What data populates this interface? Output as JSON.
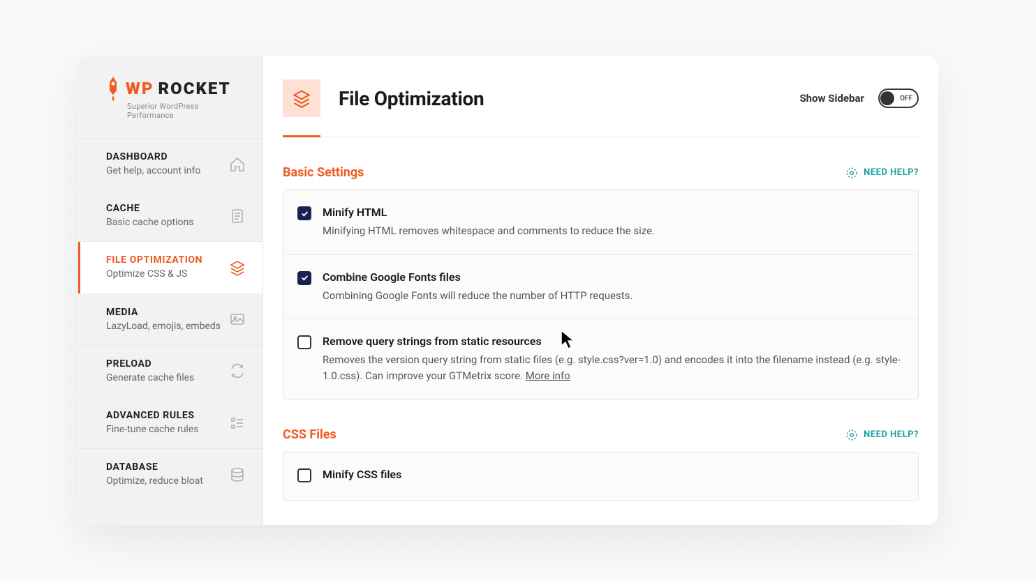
{
  "brand": {
    "wp": "WP",
    "rocket": "ROCKET",
    "tagline": "Superior WordPress Performance"
  },
  "nav": [
    {
      "title": "DASHBOARD",
      "sub": "Get help, account info"
    },
    {
      "title": "CACHE",
      "sub": "Basic cache options"
    },
    {
      "title": "FILE OPTIMIZATION",
      "sub": "Optimize CSS & JS"
    },
    {
      "title": "MEDIA",
      "sub": "LazyLoad, emojis, embeds"
    },
    {
      "title": "PRELOAD",
      "sub": "Generate cache files"
    },
    {
      "title": "ADVANCED RULES",
      "sub": "Fine-tune cache rules"
    },
    {
      "title": "DATABASE",
      "sub": "Optimize, reduce bloat"
    }
  ],
  "header": {
    "title": "File Optimization",
    "show_sidebar_label": "Show Sidebar",
    "toggle_state": "OFF"
  },
  "help_label": "NEED HELP?",
  "sections": {
    "basic": {
      "title": "Basic Settings",
      "items": [
        {
          "label": "Minify HTML",
          "desc": "Minifying HTML removes whitespace and comments to reduce the size.",
          "checked": true
        },
        {
          "label": "Combine Google Fonts files",
          "desc": "Combining Google Fonts will reduce the number of HTTP requests.",
          "checked": true
        },
        {
          "label": "Remove query strings from static resources",
          "desc_prefix": "Removes the version query string from static files (e.g. style.css?ver=1.0) and encodes it into the filename instead (e.g. style-1.0.css). Can improve your GTMetrix score. ",
          "more_info": "More info",
          "checked": false
        }
      ]
    },
    "css": {
      "title": "CSS Files",
      "items": [
        {
          "label": "Minify CSS files",
          "checked": false
        }
      ]
    }
  }
}
